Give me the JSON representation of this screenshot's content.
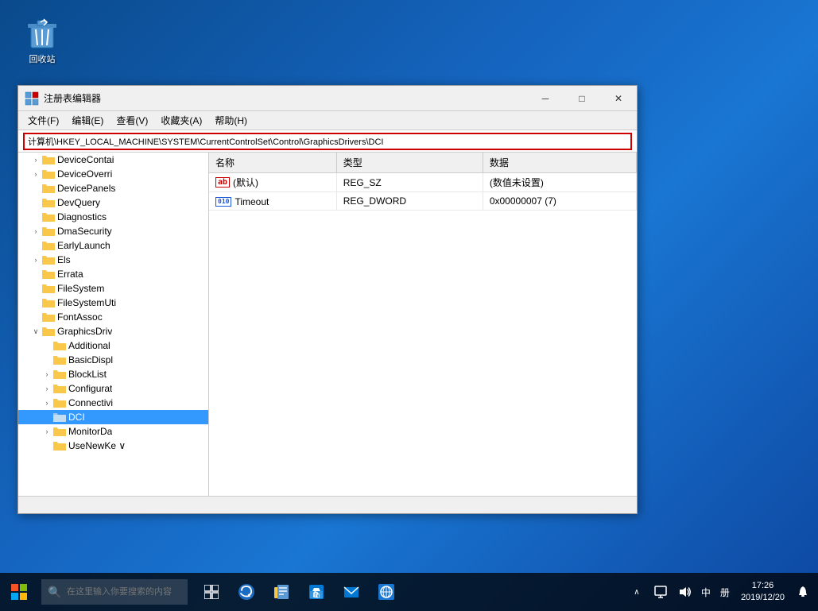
{
  "desktop": {
    "recycle_bin_label": "回收站"
  },
  "window": {
    "title": "注册表编辑器",
    "address": "计算机\\HKEY_LOCAL_MACHINE\\SYSTEM\\CurrentControlSet\\Control\\GraphicsDrivers\\DCI",
    "menu": {
      "items": [
        "文件(F)",
        "编辑(E)",
        "查看(V)",
        "收藏夹(A)",
        "帮助(H)"
      ]
    },
    "titlebar_buttons": {
      "minimize": "─",
      "maximize": "□",
      "close": "✕"
    }
  },
  "tree": {
    "items": [
      {
        "label": "DeviceContai",
        "indent": 1,
        "has_expand": true,
        "selected": false
      },
      {
        "label": "DeviceOverri",
        "indent": 1,
        "has_expand": true,
        "selected": false
      },
      {
        "label": "DevicePanels",
        "indent": 1,
        "has_expand": false,
        "selected": false
      },
      {
        "label": "DevQuery",
        "indent": 1,
        "has_expand": false,
        "selected": false
      },
      {
        "label": "Diagnostics",
        "indent": 1,
        "has_expand": false,
        "selected": false
      },
      {
        "label": "DmaSecurity",
        "indent": 1,
        "has_expand": true,
        "selected": false
      },
      {
        "label": "EarlyLaunch",
        "indent": 1,
        "has_expand": false,
        "selected": false
      },
      {
        "label": "Els",
        "indent": 1,
        "has_expand": true,
        "selected": false
      },
      {
        "label": "Errata",
        "indent": 1,
        "has_expand": false,
        "selected": false
      },
      {
        "label": "FileSystem",
        "indent": 1,
        "has_expand": false,
        "selected": false
      },
      {
        "label": "FileSystemUti",
        "indent": 1,
        "has_expand": false,
        "selected": false
      },
      {
        "label": "FontAssoc",
        "indent": 1,
        "has_expand": false,
        "selected": false
      },
      {
        "label": "GraphicsDriv",
        "indent": 1,
        "has_expand": true,
        "expanded": true,
        "selected": false
      },
      {
        "label": "Additional",
        "indent": 2,
        "has_expand": false,
        "selected": false
      },
      {
        "label": "BasicDispl",
        "indent": 2,
        "has_expand": false,
        "selected": false
      },
      {
        "label": "BlockList",
        "indent": 2,
        "has_expand": true,
        "selected": false
      },
      {
        "label": "Configurat",
        "indent": 2,
        "has_expand": true,
        "selected": false
      },
      {
        "label": "Connectivi",
        "indent": 2,
        "has_expand": true,
        "selected": false
      },
      {
        "label": "DCI",
        "indent": 2,
        "has_expand": false,
        "selected": true
      },
      {
        "label": "MonitorDa",
        "indent": 2,
        "has_expand": true,
        "selected": false
      },
      {
        "label": "UseNewKe",
        "indent": 2,
        "has_expand": false,
        "selected": false
      }
    ]
  },
  "registry_table": {
    "columns": [
      "名称",
      "类型",
      "数据"
    ],
    "rows": [
      {
        "icon": "ab",
        "icon_color": "red",
        "name": "(默认)",
        "type": "REG_SZ",
        "data": "(数值未设置)"
      },
      {
        "icon": "010",
        "icon_color": "blue",
        "name": "Timeout",
        "type": "REG_DWORD",
        "data": "0x00000007 (7)"
      }
    ]
  },
  "taskbar": {
    "search_placeholder": "在这里输入你要搜索的内容",
    "clock": {
      "time": "17:26",
      "date": "2019/12/20"
    },
    "tray": {
      "lang": "中",
      "grid_label": "册"
    }
  },
  "icons": {
    "start": "⊞",
    "search": "🔍",
    "cortana": "○",
    "task_view": "❑",
    "edge": "e",
    "explorer": "📁",
    "store": "🛍",
    "mail": "✉",
    "network": "🌐",
    "chevron_right": "›",
    "chevron_down": "∨",
    "folder": "📁",
    "recycle": "🗑"
  }
}
